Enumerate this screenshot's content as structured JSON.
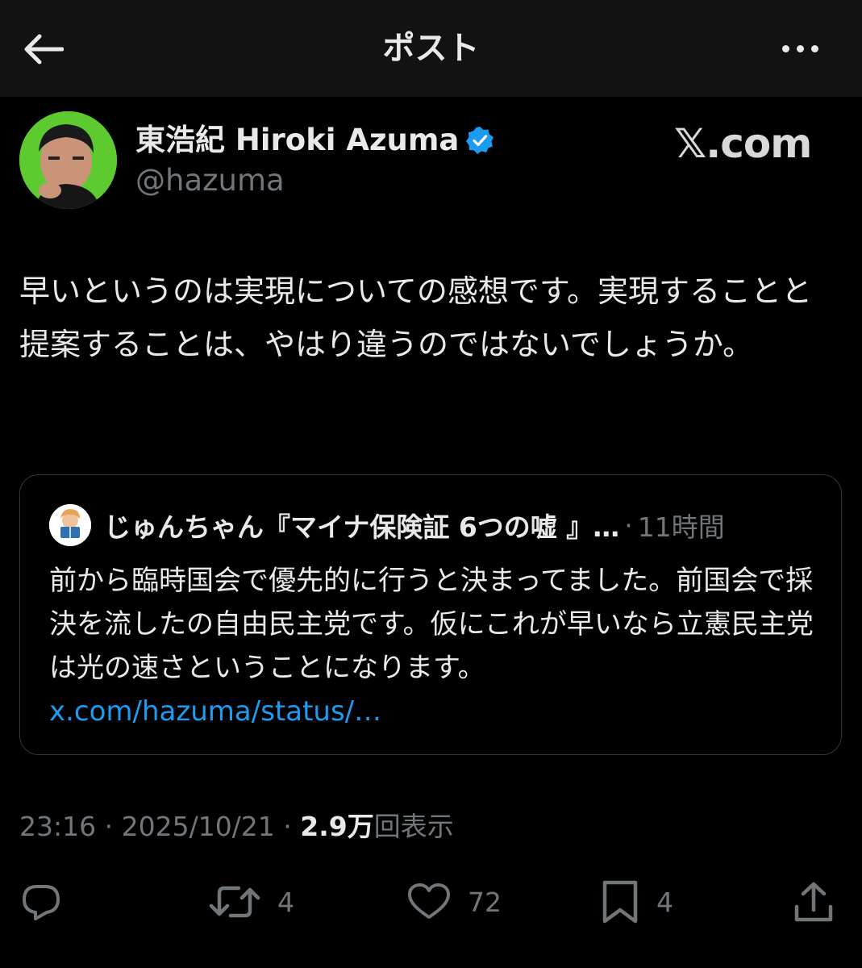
{
  "header": {
    "title": "ポスト"
  },
  "post": {
    "author_name": "東浩紀 Hiroki Azuma",
    "handle": "@hazuma",
    "brand": "𝕏.com",
    "text": "早いというのは実現についての感想です。実現することと提案することは、やはり違うのではないでしょうか。"
  },
  "quote": {
    "author_name": "じゅんちゃん『マイナ保険証 6つの嘘 』…",
    "separator": "·",
    "time": "11時間",
    "text": "前から臨時国会で優先的に行うと決まってました。前国会で採決を流したの自由民主党です。仮にこれが早いなら立憲民主党は光の速さということになります。",
    "link": "x.com/hazuma/status/…"
  },
  "meta": {
    "time": "23:16",
    "sep1": " · ",
    "date": "2025/10/21",
    "sep2": " · ",
    "views_count": "2.9万",
    "views_label": "回表示"
  },
  "actions": {
    "reply_count": "",
    "retweet_count": "4",
    "like_count": "72",
    "bookmark_count": "4"
  },
  "colors": {
    "background": "#000000",
    "header_bg": "#121212",
    "verified": "#1d9bf0",
    "link": "#1d9bf0",
    "secondary_text": "#71767b"
  },
  "icons": [
    "back-arrow-icon",
    "more-icon",
    "verified-badge-icon",
    "reply-icon",
    "retweet-icon",
    "like-icon",
    "bookmark-icon",
    "share-icon"
  ]
}
